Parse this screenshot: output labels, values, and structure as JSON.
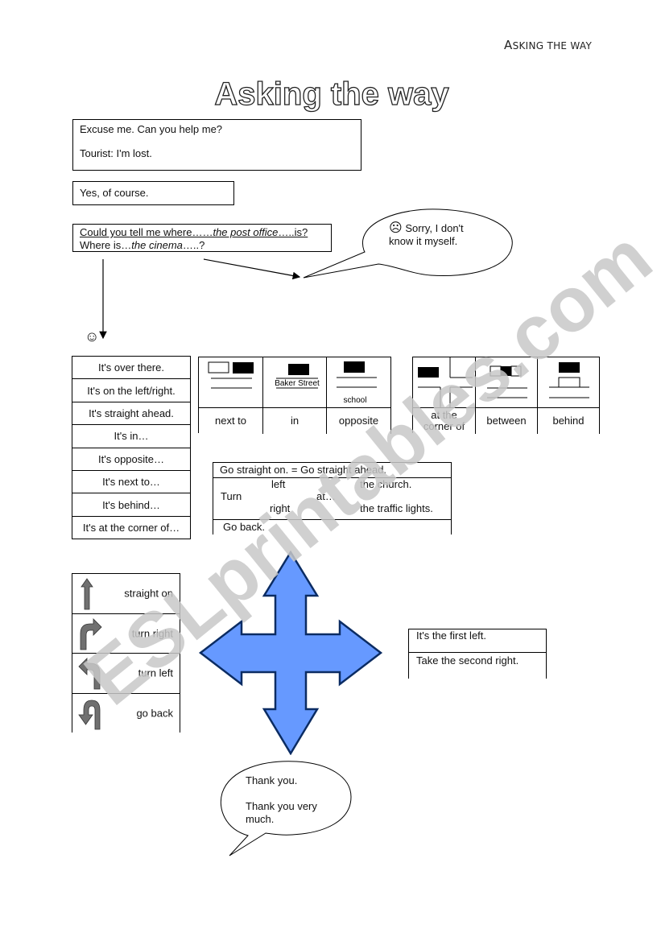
{
  "header": {
    "running_title_first": "A",
    "running_title_rest": "SKING THE WAY",
    "main_title": "Asking the way"
  },
  "dialogue": {
    "box1_line1": "Excuse me. Can you help me?",
    "box1_line2": "Tourist: I'm lost.",
    "box2": "Yes, of course.",
    "box3_q1_a": "Could you tell me where……",
    "box3_q1_b": "the post office",
    "box3_q1_c": "…..is?",
    "box3_q2_a": "Where is…",
    "box3_q2_b": "the cinema",
    "box3_q2_c": "…..?",
    "sorry_icon": "☹",
    "sorry_line1": "Sorry, I don't",
    "sorry_line2": "know it myself.",
    "happy_icon": "☺"
  },
  "phrases": [
    "It's over there.",
    "It's on the left/right.",
    "It's straight ahead.",
    "It's in…",
    "It's opposite…",
    "It's next to…",
    "It's behind…",
    "It's at the corner of…"
  ],
  "prepositions_left": [
    {
      "label": "next to",
      "icon": "next-to-diagram"
    },
    {
      "label": "in",
      "icon": "in-diagram",
      "caption": "Baker Street"
    },
    {
      "label": "opposite",
      "icon": "opposite-diagram",
      "caption": "school"
    }
  ],
  "prepositions_right": [
    {
      "label_line1": "at the",
      "label_line2": "corner of",
      "icon": "corner-diagram"
    },
    {
      "label": "between",
      "icon": "between-diagram"
    },
    {
      "label": "behind",
      "icon": "behind-diagram"
    }
  ],
  "directions": {
    "row1": "Go straight on. = Go straight ahead.",
    "turn": "Turn",
    "left": "left",
    "right": "right",
    "at": "at…",
    "church": "the church.",
    "traffic_lights": "the traffic lights.",
    "go_back": "Go back."
  },
  "turns": [
    {
      "label": "straight on",
      "icon": "arrow-up-icon"
    },
    {
      "label": "turn right",
      "icon": "turn-right-icon"
    },
    {
      "label": "turn left",
      "icon": "turn-left-icon"
    },
    {
      "label": "go back",
      "icon": "u-turn-icon"
    }
  ],
  "ordinals": {
    "first": "It's the first left.",
    "second": "Take the second right."
  },
  "thanks": {
    "line1": "Thank you.",
    "line2": "Thank you very",
    "line3": "much."
  },
  "watermark": "ESLprintables.com",
  "colors": {
    "arrow_fill": "#6699ff",
    "arrow_stroke": "#0b2c63",
    "turn_arrow_fill": "#707070",
    "watermark": "#c8c8c8"
  }
}
